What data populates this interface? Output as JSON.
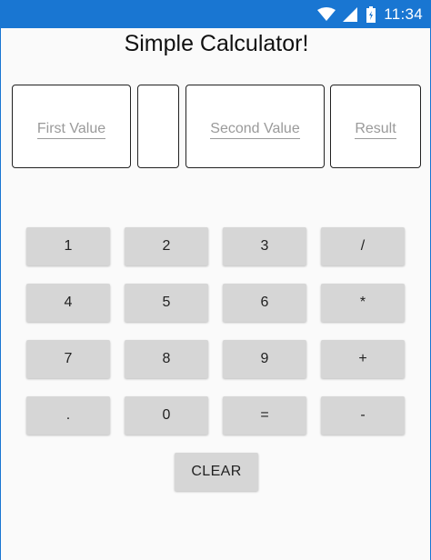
{
  "status_bar": {
    "time": "11:34",
    "icons": [
      "wifi-icon",
      "cell-signal-icon",
      "battery-icon"
    ],
    "color": "#1976d2"
  },
  "title": "Simple Calculator!",
  "inputs": {
    "first_placeholder": "First Value",
    "operator_value": "",
    "second_placeholder": "Second Value",
    "result_placeholder": "Result"
  },
  "keypad": {
    "row1": [
      "1",
      "2",
      "3",
      "/"
    ],
    "row2": [
      "4",
      "5",
      "6",
      "*"
    ],
    "row3": [
      "7",
      "8",
      "9",
      "+"
    ],
    "row4": [
      ".",
      "0",
      "=",
      "-"
    ]
  },
  "clear_label": "CLEAR",
  "colors": {
    "background": "#fafafa",
    "button": "#d6d6d6",
    "placeholder": "#9a9a9a"
  }
}
